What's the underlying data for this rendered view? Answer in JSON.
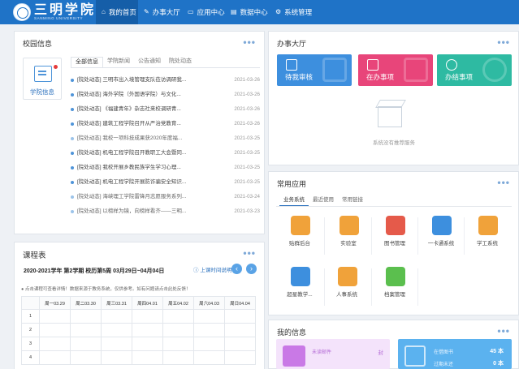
{
  "header": {
    "brand": "三明学院",
    "brand_sub": "SANMING UNIVERSITY",
    "nav": [
      {
        "icon": "home-icon",
        "glyph": "⌂",
        "label": "我的首页"
      },
      {
        "icon": "edit-icon",
        "glyph": "✎",
        "label": "办事大厅"
      },
      {
        "icon": "desktop-icon",
        "glyph": "▭",
        "label": "应用中心"
      },
      {
        "icon": "chart-icon",
        "glyph": "▤",
        "label": "数据中心"
      },
      {
        "icon": "gear-icon",
        "glyph": "⚙",
        "label": "系统管理"
      }
    ]
  },
  "campus": {
    "title": "校园信息",
    "more": "•••",
    "side_label": "学院信息",
    "tabs": [
      "全部信息",
      "学院新闻",
      "公告通知",
      "院处动态"
    ],
    "news": [
      {
        "text": "[院处动态] 三明市出入境管理支队莅访调研我...",
        "date": "2021-03-26"
      },
      {
        "text": "[院处动态] 海外学院（外国语学院）与文化...",
        "date": "2021-03-26"
      },
      {
        "text": "[院处动态] 《福建青年》杂志社来校调研青...",
        "date": "2021-03-26"
      },
      {
        "text": "[院处动态] 建筑工程学院召开从严治党教育...",
        "date": "2021-03-26"
      },
      {
        "text": "[院处动态] 我校一项科技成果获2020年度福...",
        "date": "2021-03-25"
      },
      {
        "text": "[院处动态] 机电工程学院召开教职工大会暨同...",
        "date": "2021-03-25"
      },
      {
        "text": "[院处动态] 我校开展乡教民族学生学习心理...",
        "date": "2021-03-25"
      },
      {
        "text": "[院处动态] 机电工程学院开展防诈骗安全知识...",
        "date": "2021-03-25"
      },
      {
        "text": "[院处动态] 海峡理工学院雷锋月志愿服务系列...",
        "date": "2021-03-24"
      },
      {
        "text": "[院处动态] 以榜样为镜，向榜样看齐——三明...",
        "date": "2021-03-23"
      }
    ]
  },
  "schedule": {
    "title": "课程表",
    "more": "•••",
    "semester": "2020-2021学年 第2学期 校历第5周    03月29日~04月04日",
    "explain_link": "上课时间说明",
    "prev": "‹",
    "next": "›",
    "note": "点击课程可查看详情！数据来源于教务系统，仅供参考。如有问题请点击此处反馈！",
    "days": [
      "周一03.29",
      "周二03.30",
      "周三03.31",
      "周四04.01",
      "周五04.02",
      "周六04.03",
      "周日04.04"
    ],
    "periods": [
      "1",
      "2",
      "3",
      "4"
    ]
  },
  "hall": {
    "title": "办事大厅",
    "more": "•••",
    "tiles": [
      {
        "label": "待我审核",
        "color": "#3d8fde"
      },
      {
        "label": "在办事项",
        "color": "#e8457a"
      },
      {
        "label": "办结事项",
        "color": "#2ebaa2"
      }
    ],
    "empty_text": "系统没有推荐服务"
  },
  "apps": {
    "title": "常用应用",
    "more": "•••",
    "tabs": [
      "业务系统",
      "最近使用",
      "常用链接"
    ],
    "items": [
      {
        "label": "贴群后台",
        "icon": "house-icon",
        "color": "#f0a23a"
      },
      {
        "label": "实验室",
        "icon": "lab-icon",
        "color": "#f0a23a"
      },
      {
        "label": "图书管理",
        "icon": "book-icon",
        "color": "#e55a4a"
      },
      {
        "label": "一卡通系统",
        "icon": "card-icon",
        "color": "#3d8fde"
      },
      {
        "label": "学工系统",
        "icon": "student-icon",
        "color": "#f0a23a"
      },
      {
        "label": "超星教学...",
        "icon": "teach-icon",
        "color": "#3d8fde"
      },
      {
        "label": "人事系统",
        "icon": "hr-icon",
        "color": "#f0a23a"
      },
      {
        "label": "档案管理",
        "icon": "archive-icon",
        "color": "#5bbf4e"
      }
    ]
  },
  "myinfo": {
    "title": "我的信息",
    "more": "•••",
    "unread_label": "未读邮件",
    "unread_value": "封",
    "borrowed_label": "在借图书",
    "borrowed_value": "45 本",
    "overdue_label": "过期未还",
    "overdue_value": "0 本"
  }
}
